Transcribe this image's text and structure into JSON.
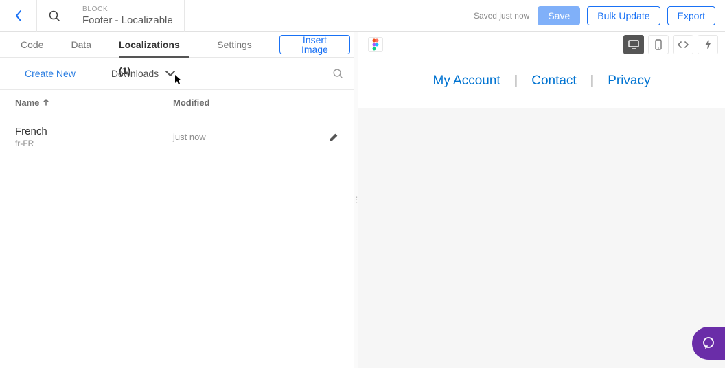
{
  "header": {
    "type_label": "BLOCK",
    "title": "Footer - Localizable",
    "status": "Saved just now",
    "save_label": "Save",
    "bulk_label": "Bulk Update",
    "export_label": "Export"
  },
  "tabs": {
    "code": "Code",
    "data": "Data",
    "localizations": "Localizations (1)",
    "settings": "Settings",
    "insert_image": "Insert Image"
  },
  "subrow": {
    "create_new": "Create New",
    "downloads": "Downloads"
  },
  "columns": {
    "name": "Name",
    "modified": "Modified"
  },
  "rows": [
    {
      "lang": "French",
      "code": "fr-FR",
      "modified": "just now"
    }
  ],
  "preview": {
    "links": {
      "account": "My Account",
      "contact": "Contact",
      "privacy": "Privacy"
    },
    "separator": "|"
  }
}
